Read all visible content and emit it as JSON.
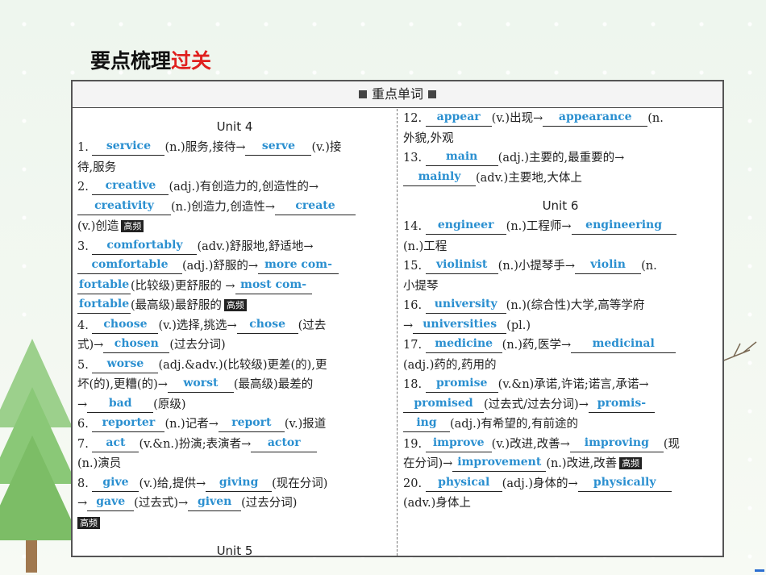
{
  "title": {
    "main": "要点梳理",
    "highlight": "过关"
  },
  "card": {
    "header": "重点单词",
    "badge": "高频"
  },
  "left": {
    "unit4": "Unit 4",
    "unit5": "Unit 5",
    "r1": {
      "num": "1.",
      "b1": "service",
      "t1": "(n.)服务,接待→",
      "b2": "serve",
      "t2": "(v.)接"
    },
    "r1b": "待,服务",
    "r2": {
      "num": "2.",
      "b1": "creative",
      "t1": "(adj.)有创造力的,创造性的→"
    },
    "r2b": {
      "b1": "creativity",
      "t1": "(n.)创造力,创造性→",
      "b2": "create"
    },
    "r2c": "(v.)创造",
    "r3": {
      "num": "3.",
      "b1": "comfortably",
      "t1": "(adv.)舒服地,舒适地→"
    },
    "r3b": {
      "b1": "comfortable",
      "t1": "(adj.)舒服的→",
      "b2": "more com-"
    },
    "r3c": {
      "b1": "fortable",
      "t1": "(比较级)更舒服的 →",
      "b2": "most com-"
    },
    "r3d": {
      "b1": "fortable",
      "t1": "(最高级)最舒服的"
    },
    "r4": {
      "num": "4.",
      "b1": "choose",
      "t1": "(v.)选择,挑选→",
      "b2": "chose",
      "t2": "(过去"
    },
    "r4b": {
      "t0": "式)→",
      "b1": "chosen",
      "t1": "(过去分词)"
    },
    "r5": {
      "num": "5.",
      "b1": "worse",
      "t1": "(adj.&adv.)(比较级)更差(的),更"
    },
    "r5b": {
      "t0": "坏(的),更糟(的)→",
      "b1": "worst",
      "t1": "(最高级)最差的"
    },
    "r5c": {
      "t0": "→",
      "b1": "bad",
      "t1": "(原级)"
    },
    "r6": {
      "num": "6.",
      "b1": "reporter",
      "t1": "(n.)记者→",
      "b2": "report",
      "t2": "(v.)报道"
    },
    "r7": {
      "num": "7.",
      "b1": "act",
      "t1": "(v.&n.)扮演;表演者→",
      "b2": "actor"
    },
    "r7b": "(n.)演员",
    "r8": {
      "num": "8.",
      "b1": "give",
      "t1": "(v.)给,提供→",
      "b2": "giving",
      "t2": "(现在分词)"
    },
    "r8b": {
      "t0": "→",
      "b1": "gave",
      "t1": "(过去式)→",
      "b2": "given",
      "t2": "(过去分词)"
    }
  },
  "right": {
    "unit6": "Unit 6",
    "r12": {
      "num": "12.",
      "b1": "appear",
      "t1": "(v.)出现→",
      "b2": "appearance",
      "t2": "(n."
    },
    "r12b": "外貌,外观",
    "r13": {
      "num": "13.",
      "b1": "main",
      "t1": "(adj.)主要的,最重要的→"
    },
    "r13b": {
      "b1": "mainly",
      "t1": "(adv.)主要地,大体上"
    },
    "r14": {
      "num": "14.",
      "b1": "engineer",
      "t1": "(n.)工程师→",
      "b2": "engineering"
    },
    "r14b": "(n.)工程",
    "r15": {
      "num": "15.",
      "b1": "violinist",
      "t1": "(n.)小提琴手→",
      "b2": "violin",
      "t2": "(n."
    },
    "r15b": "小提琴",
    "r16": {
      "num": "16.",
      "b1": "university",
      "t1": "(n.)(综合性)大学,高等学府"
    },
    "r16b": {
      "t0": "→",
      "b1": "universities",
      "t1": "(pl.)"
    },
    "r17": {
      "num": "17.",
      "b1": "medicine",
      "t1": "(n.)药,医学→",
      "b2": "medicinal"
    },
    "r17b": "(adj.)药的,药用的",
    "r18": {
      "num": "18.",
      "b1": "promise",
      "t1": "(v.&n)承诺,许诺;诺言,承诺→"
    },
    "r18b": {
      "b1": "promised",
      "t1": "(过去式/过去分词)→",
      "b2": "promis-"
    },
    "r18c": {
      "b1": "ing",
      "t1": "(adj.)有希望的,有前途的"
    },
    "r19": {
      "num": "19.",
      "b1": "improve",
      "t1": "(v.)改进,改善→",
      "b2": "improving",
      "t2": "(现"
    },
    "r19b": {
      "t0": "在分词)→",
      "b1": "improvement",
      "t1": "(n.)改进,改善"
    },
    "r20": {
      "num": "20.",
      "b1": "physical",
      "t1": "(adj.)身体的→",
      "b2": "physically"
    },
    "r20b": "(adv.)身体上"
  }
}
